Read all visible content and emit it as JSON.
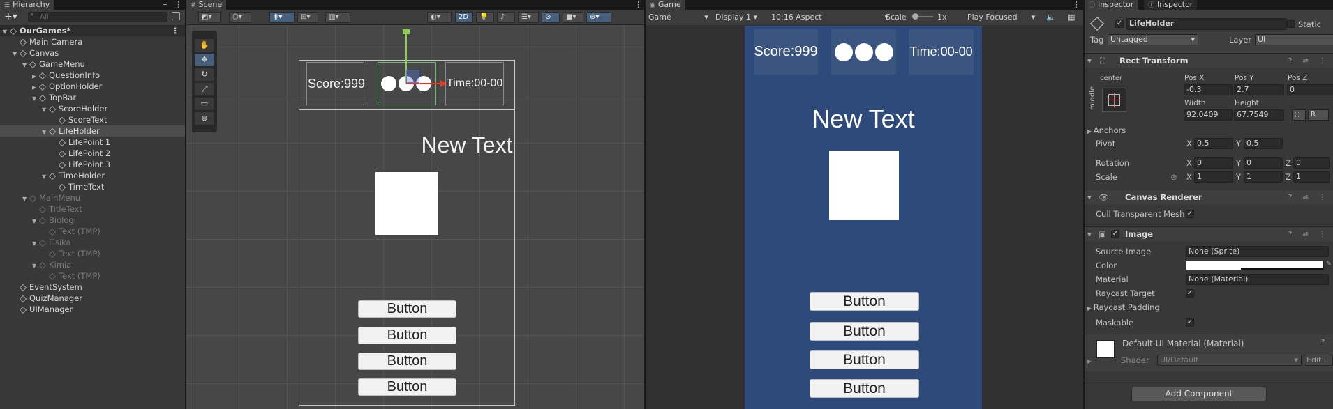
{
  "hierarchy": {
    "tab": "Hierarchy",
    "search_placeholder": "All",
    "rows": [
      {
        "label": "OurGames*",
        "depth": 0,
        "expanded": true,
        "root": true,
        "dim": false
      },
      {
        "label": "Main Camera",
        "depth": 1,
        "expanded": null,
        "dim": false
      },
      {
        "label": "Canvas",
        "depth": 1,
        "expanded": true,
        "dim": false
      },
      {
        "label": "GameMenu",
        "depth": 2,
        "expanded": true,
        "dim": false
      },
      {
        "label": "QuestionInfo",
        "depth": 3,
        "expanded": false,
        "dim": false
      },
      {
        "label": "OptionHolder",
        "depth": 3,
        "expanded": false,
        "dim": false
      },
      {
        "label": "TopBar",
        "depth": 3,
        "expanded": true,
        "dim": false
      },
      {
        "label": "ScoreHolder",
        "depth": 4,
        "expanded": true,
        "dim": false
      },
      {
        "label": "ScoreText",
        "depth": 5,
        "expanded": null,
        "dim": false
      },
      {
        "label": "LifeHolder",
        "depth": 4,
        "expanded": true,
        "dim": false,
        "selected": true
      },
      {
        "label": "LifePoint 1",
        "depth": 5,
        "expanded": null,
        "dim": false
      },
      {
        "label": "LifePoint 2",
        "depth": 5,
        "expanded": null,
        "dim": false
      },
      {
        "label": "LifePoint 3",
        "depth": 5,
        "expanded": null,
        "dim": false
      },
      {
        "label": "TimeHolder",
        "depth": 4,
        "expanded": true,
        "dim": false
      },
      {
        "label": "TimeText",
        "depth": 5,
        "expanded": null,
        "dim": false
      },
      {
        "label": "MainMenu",
        "depth": 2,
        "expanded": true,
        "dim": true
      },
      {
        "label": "TitleText",
        "depth": 3,
        "expanded": null,
        "dim": true
      },
      {
        "label": "Biologi",
        "depth": 3,
        "expanded": true,
        "dim": true
      },
      {
        "label": "Text (TMP)",
        "depth": 4,
        "expanded": null,
        "dim": true
      },
      {
        "label": "Fisika",
        "depth": 3,
        "expanded": true,
        "dim": true
      },
      {
        "label": "Text (TMP)",
        "depth": 4,
        "expanded": null,
        "dim": true
      },
      {
        "label": "Kimia",
        "depth": 3,
        "expanded": true,
        "dim": true
      },
      {
        "label": "Text (TMP)",
        "depth": 4,
        "expanded": null,
        "dim": true
      },
      {
        "label": "EventSystem",
        "depth": 1,
        "expanded": null,
        "dim": false
      },
      {
        "label": "QuizManager",
        "depth": 1,
        "expanded": null,
        "dim": false
      },
      {
        "label": "UIManager",
        "depth": 1,
        "expanded": null,
        "dim": false
      }
    ]
  },
  "scene": {
    "tab": "Scene",
    "mode_2d": "2D",
    "score": "Score:999",
    "time": "Time:00-00",
    "title": "New Text",
    "buttons": [
      "Button",
      "Button",
      "Button",
      "Button"
    ]
  },
  "game": {
    "tab": "Game",
    "display_select": "Game",
    "display": "Display 1",
    "aspect": "10:16 Aspect",
    "scale_label": "Scale",
    "scale_value": "1x",
    "play_mode": "Play Focused",
    "score": "Score:999",
    "time": "Time:00-00",
    "title": "New Text",
    "buttons": [
      "Button",
      "Button",
      "Button",
      "Button"
    ],
    "bg_color": "#2d4a7a"
  },
  "inspector": {
    "tabs": [
      "Inspector",
      "Inspector"
    ],
    "object_name": "LifeHolder",
    "static_label": "Static",
    "tag_label": "Tag",
    "tag_value": "Untagged",
    "layer_label": "Layer",
    "layer_value": "UI",
    "rect_transform": {
      "title": "Rect Transform",
      "anchor_h": "center",
      "anchor_v": "middle",
      "pos_x_label": "Pos X",
      "pos_y_label": "Pos Y",
      "pos_z_label": "Pos Z",
      "pos_x": "-0.3",
      "pos_y": "2.7",
      "pos_z": "0",
      "width_label": "Width",
      "height_label": "Height",
      "width": "92.0409",
      "height": "67.7549",
      "r_btn": "R",
      "anchors_label": "Anchors",
      "pivot_label": "Pivot",
      "pivot_x": "0.5",
      "pivot_y": "0.5",
      "rotation_label": "Rotation",
      "rot_x": "0",
      "rot_y": "0",
      "rot_z": "0",
      "scale_label": "Scale",
      "scale_x": "1",
      "scale_y": "1",
      "scale_z": "1",
      "x": "X",
      "y": "Y",
      "z": "Z"
    },
    "canvas_renderer": {
      "title": "Canvas Renderer",
      "cull_label": "Cull Transparent Mesh"
    },
    "image": {
      "title": "Image",
      "source_label": "Source Image",
      "source_value": "None (Sprite)",
      "color_label": "Color",
      "material_label": "Material",
      "material_value": "None (Material)",
      "raycast_label": "Raycast Target",
      "padding_label": "Raycast Padding",
      "maskable_label": "Maskable"
    },
    "material": {
      "name": "Default UI Material (Material)",
      "shader_label": "Shader",
      "shader_value": "UI/Default",
      "edit_label": "Edit..."
    },
    "add_component": "Add Component"
  }
}
